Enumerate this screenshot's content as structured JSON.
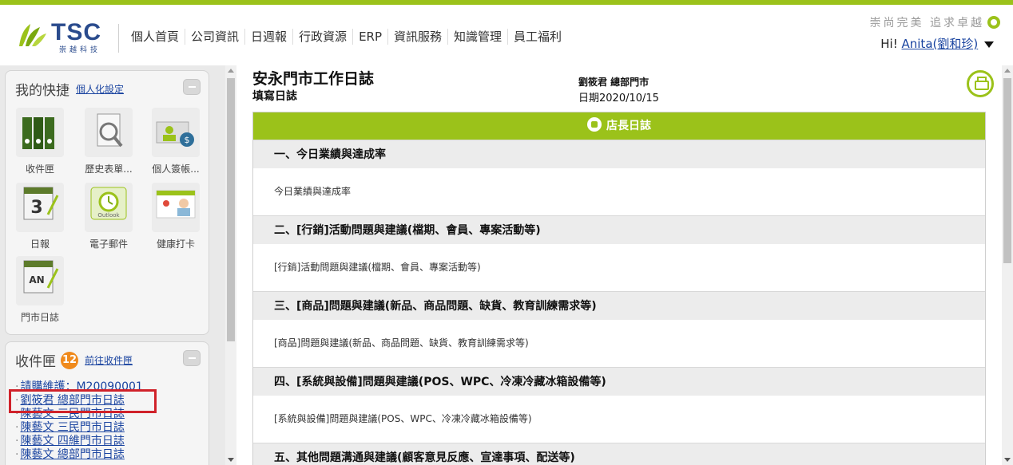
{
  "header": {
    "logo_text": "TSC",
    "logo_sub": "崇越科技",
    "slogan": "崇尚完美 追求卓越",
    "greeting": "Hi!",
    "user_name": "Anita(劉和珍)",
    "nav": [
      "個人首頁",
      "公司資訊",
      "日週報",
      "行政資源",
      "ERP",
      "資訊服務",
      "知識管理",
      "員工福利"
    ]
  },
  "quick": {
    "title": "我的快捷",
    "settings_link": "個人化設定",
    "items": [
      {
        "label": "收件匣",
        "icon": "binders-icon"
      },
      {
        "label": "歷史表單...",
        "icon": "history-forms-icon"
      },
      {
        "label": "個人簽帳...",
        "icon": "personal-account-icon"
      },
      {
        "label": "日報",
        "icon": "calendar-icon"
      },
      {
        "label": "電子郵件",
        "icon": "outlook-icon"
      },
      {
        "label": "健康打卡",
        "icon": "health-check-icon"
      },
      {
        "label": "門市日誌",
        "icon": "store-log-icon"
      }
    ],
    "outlook_text": "Outlook",
    "calendar_day": "3",
    "store_icon_text": "AN"
  },
  "inbox": {
    "title": "收件匣",
    "count": "12",
    "link": "前往收件匣",
    "items": [
      "請購維護：M20090001",
      "劉筱君 總部門市日誌",
      "陳藝文 三民門市日誌",
      "陳藝文 三民門市日誌",
      "陳藝文 四維門市日誌",
      "陳藝文 總部門市日誌"
    ]
  },
  "main": {
    "title": "安永門市工作日誌",
    "subtitle": "填寫日誌",
    "author": "劉筱君 總部門市",
    "date": "日期2020/10/15",
    "journal_title": "店長日誌",
    "sections": [
      {
        "heading": "一、今日業績與達成率",
        "body": "今日業績與達成率"
      },
      {
        "heading": "二、[行銷]活動問題與建議(檔期、會員、專案活動等)",
        "body": "[行銷]活動問題與建議(檔期、會員、專案活動等)"
      },
      {
        "heading": "三、[商品]問題與建議(新品、商品問題、缺貨、教育訓練需求等)",
        "body": "[商品]問題與建議(新品、商品問題、缺貨、教育訓練需求等)"
      },
      {
        "heading": "四、[系統與設備]問題與建議(POS、WPC、冷凍冷藏冰箱設備等)",
        "body": "[系統與設備]問題與建議(POS、WPC、冷凍冷藏冰箱設備等)"
      },
      {
        "heading": "五、其他問題溝通與建議(顧客意見反應、宣達事項、配送等)",
        "body": ""
      }
    ]
  },
  "colors": {
    "accent": "#9bc21a",
    "badge": "#f08a1c",
    "highlight": "#d0222a",
    "link": "#1a44a0"
  }
}
